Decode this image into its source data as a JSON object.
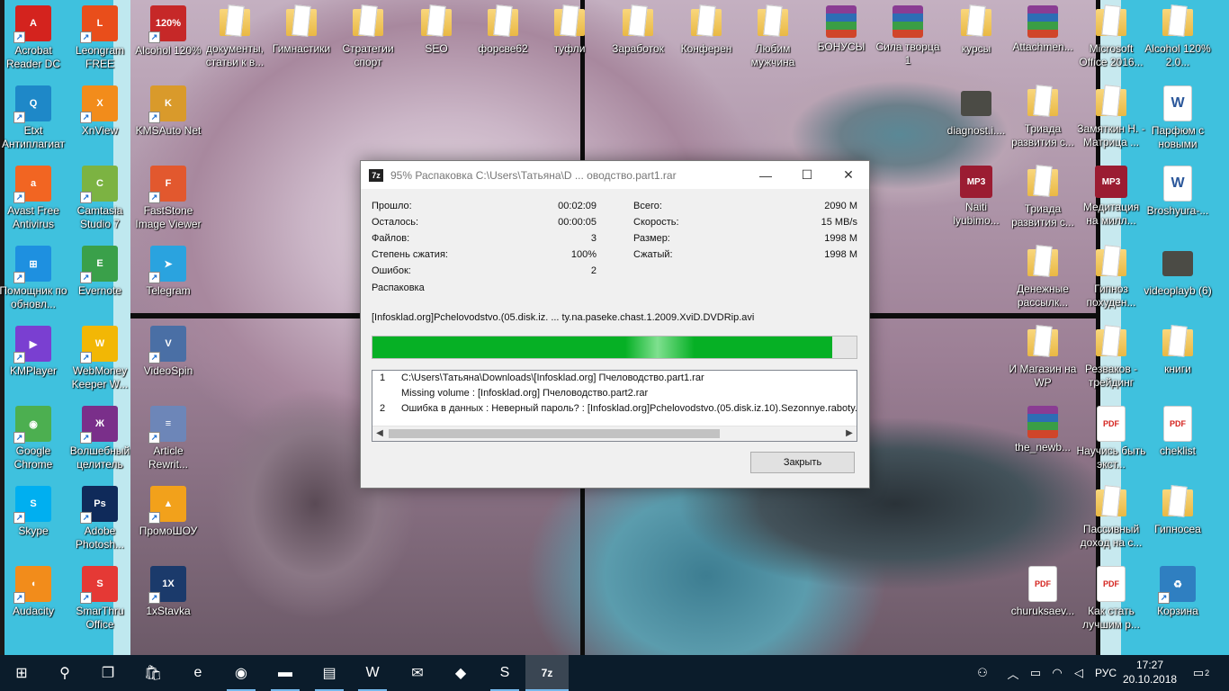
{
  "desktop": {
    "icons": [
      {
        "label": "Acrobat Reader DC",
        "icon": "acrobat-icon",
        "color": "#d4231e",
        "glyph": "A"
      },
      {
        "label": "Leongram FREE",
        "icon": "leongram-icon",
        "color": "#e94e1b",
        "glyph": "L"
      },
      {
        "label": "Alcohol 120%",
        "icon": "alcohol-icon",
        "color": "#c62828",
        "glyph": "120%"
      },
      {
        "label": "документы, статьи к в...",
        "icon": "folder-icon"
      },
      {
        "label": "Гимнастики",
        "icon": "folder-icon"
      },
      {
        "label": "Стратегии спорт",
        "icon": "folder-icon"
      },
      {
        "label": "SEO",
        "icon": "folder-icon"
      },
      {
        "label": "форсве62",
        "icon": "folder-icon"
      },
      {
        "label": "туфли",
        "icon": "folder-icon"
      },
      {
        "label": "Заработок",
        "icon": "folder-icon"
      },
      {
        "label": "Конферен",
        "icon": "folder-icon"
      },
      {
        "label": "Любим мужчина",
        "icon": "folder-icon"
      },
      {
        "label": "БОНУСЫ",
        "icon": "rar-archive-icon"
      },
      {
        "label": "Сила творца 1",
        "icon": "rar-archive-icon"
      },
      {
        "label": "курсы",
        "icon": "folder-icon"
      },
      {
        "label": "Attachmen...",
        "icon": "rar-archive-icon"
      },
      {
        "label": "Microsoft Office 2016...",
        "icon": "folder-icon"
      },
      {
        "label": "Alcohol 120% 2.0...",
        "icon": "folder-icon"
      },
      {
        "label": "Etxt Антиплагиат",
        "icon": "etxt-icon",
        "color": "#1e88c8",
        "glyph": "Q"
      },
      {
        "label": "XnView",
        "icon": "xnview-icon",
        "color": "#f28c1b",
        "glyph": "X"
      },
      {
        "label": "KMSAuto Net",
        "icon": "kmsauto-icon",
        "color": "#d99a2b",
        "glyph": "K"
      },
      {
        "label": "diagnost.i....",
        "icon": "video-thumbnail-icon"
      },
      {
        "label": "Триада развития с...",
        "icon": "folder-icon"
      },
      {
        "label": "Замяткин Н. - Матрица ...",
        "icon": "folder-icon"
      },
      {
        "label": "Парфюм с новыми",
        "icon": "word-document-icon"
      },
      {
        "label": "Avast Free Antivirus",
        "icon": "avast-icon",
        "color": "#f26522",
        "glyph": "a"
      },
      {
        "label": "Camtasia Studio 7",
        "icon": "camtasia-icon",
        "color": "#7cb342",
        "glyph": "C"
      },
      {
        "label": "FastStone Image Viewer",
        "icon": "faststone-icon",
        "color": "#e2582e",
        "glyph": "F"
      },
      {
        "label": "Naiti lyubimo...",
        "icon": "mp3-icon"
      },
      {
        "label": "Триада развития с...",
        "icon": "folder-icon"
      },
      {
        "label": "Медитация на милл...",
        "icon": "mp3-icon"
      },
      {
        "label": "Broshyura-...",
        "icon": "word-document-icon"
      },
      {
        "label": "Помощник по обновл...",
        "icon": "windows-update-icon",
        "color": "#1e90e0",
        "glyph": "⊞"
      },
      {
        "label": "Evernote",
        "icon": "evernote-icon",
        "color": "#3aa04a",
        "glyph": "E"
      },
      {
        "label": "Telegram",
        "icon": "telegram-icon",
        "color": "#2aa3df",
        "glyph": "➤"
      },
      {
        "label": "Денежные рассылк...",
        "icon": "folder-icon"
      },
      {
        "label": "Гипноз похуден...",
        "icon": "folder-icon"
      },
      {
        "label": "videoplayb (6)",
        "icon": "video-thumbnail-icon"
      },
      {
        "label": "KMPlayer",
        "icon": "kmplayer-icon",
        "color": "#7a3fd1",
        "glyph": "▶"
      },
      {
        "label": "WebMoney Keeper W...",
        "icon": "webmoney-icon",
        "color": "#f2b705",
        "glyph": "W"
      },
      {
        "label": "VideoSpin",
        "icon": "videospin-icon",
        "color": "#4a6fa5",
        "glyph": "V"
      },
      {
        "label": "И Магазин на WP",
        "icon": "folder-icon"
      },
      {
        "label": "Резваков - трейдинг",
        "icon": "folder-icon"
      },
      {
        "label": "книги",
        "icon": "folder-icon"
      },
      {
        "label": "Google Chrome",
        "icon": "chrome-icon",
        "color": "#4caf50",
        "glyph": "◉"
      },
      {
        "label": "Волшебный целитель",
        "icon": "healer-icon",
        "color": "#7a2f8a",
        "glyph": "Ж"
      },
      {
        "label": "Article Rewrit...",
        "icon": "article-rewriter-icon",
        "color": "#6d86b8",
        "glyph": "≡"
      },
      {
        "label": "the_newb...",
        "icon": "rar-archive-icon"
      },
      {
        "label": "Научись быть экст...",
        "icon": "pdf-icon"
      },
      {
        "label": "cheklist",
        "icon": "pdf-icon"
      },
      {
        "label": "Skype",
        "icon": "skype-icon",
        "color": "#00aff0",
        "glyph": "S"
      },
      {
        "label": "Adobe Photosh...",
        "icon": "photoshop-icon",
        "color": "#0f2a5a",
        "glyph": "Ps"
      },
      {
        "label": "ПромоШОУ",
        "icon": "promoshow-icon",
        "color": "#f2a11b",
        "glyph": "▲"
      },
      {
        "label": "Пассивный доход на с...",
        "icon": "folder-icon"
      },
      {
        "label": "Гипносеа",
        "icon": "folder-icon"
      },
      {
        "label": "Audacity",
        "icon": "audacity-icon",
        "color": "#f28c1b",
        "glyph": "◖"
      },
      {
        "label": "SmarThru Office",
        "icon": "smarthru-icon",
        "color": "#e53935",
        "glyph": "S"
      },
      {
        "label": "1xStavka",
        "icon": "1xstavka-icon",
        "color": "#1b3a6b",
        "glyph": "1X"
      },
      {
        "label": "churuksaev...",
        "icon": "pdf-icon"
      },
      {
        "label": "Как стать лучшим р...",
        "icon": "pdf-icon"
      },
      {
        "label": "Корзина",
        "icon": "recycle-bin-icon",
        "color": "#2f7fc1",
        "glyph": "♻"
      }
    ]
  },
  "dialog": {
    "icon_label": "7z",
    "title": "95% Распаковка C:\\Users\\Татьяна\\D ... оводство.part1.rar",
    "stats_left": [
      {
        "label": "Прошло:",
        "value": "00:02:09"
      },
      {
        "label": "Осталось:",
        "value": "00:00:05"
      },
      {
        "label": "Файлов:",
        "value": "3"
      },
      {
        "label": "Степень сжатия:",
        "value": "100%"
      },
      {
        "label": "Ошибок:",
        "value": "2"
      }
    ],
    "stats_right": [
      {
        "label": "Всего:",
        "value": "2090 M"
      },
      {
        "label": "Скорость:",
        "value": "15 MB/s"
      },
      {
        "label": "Размер:",
        "value": "1998 M"
      },
      {
        "label": "Сжатый:",
        "value": "1998 M"
      }
    ],
    "operation": "Распаковка",
    "current_file": "[Infosklad.org]Pchelovodstvo.(05.disk.iz. ... ty.na.paseke.chast.1.2009.XviD.DVDRip.avi",
    "progress": 0.95,
    "log": [
      {
        "num": "1",
        "text": "C:\\Users\\Татьяна\\Downloads\\[Infosklad.org] Пчеловодство.part1.rar"
      },
      {
        "num": "",
        "text": "Missing volume : [Infosklad.org] Пчеловодство.part2.rar"
      },
      {
        "num": "2",
        "text": "Ошибка в данных : Неверный пароль? : [Infosklad.org]Pchelovodstvo.(05.disk.iz.10).Sezonnye.raboty.na"
      }
    ],
    "close_label": "Закрыть"
  },
  "taskbar": {
    "items": [
      {
        "icon": "windows-start-icon",
        "glyph": "⊞"
      },
      {
        "icon": "search-icon",
        "glyph": "⚲"
      },
      {
        "icon": "task-view-icon",
        "glyph": "❐"
      },
      {
        "icon": "store-icon",
        "glyph": "🛍"
      },
      {
        "icon": "edge-icon",
        "glyph": "e"
      },
      {
        "icon": "chrome-icon",
        "glyph": "◉"
      },
      {
        "icon": "file-explorer-icon",
        "glyph": "▬"
      },
      {
        "icon": "winrar-icon",
        "glyph": "▤"
      },
      {
        "icon": "word-icon",
        "glyph": "W"
      },
      {
        "icon": "mail-icon",
        "glyph": "✉"
      },
      {
        "icon": "sticky-app-icon",
        "glyph": "◆"
      },
      {
        "icon": "skype-icon",
        "glyph": "S"
      },
      {
        "icon": "7zip-icon",
        "glyph": "7z"
      }
    ],
    "language": "РУС",
    "time": "17:27",
    "date": "20.10.2018",
    "notification_count": "2"
  },
  "colors": {
    "progress_green": "#06b025",
    "taskbar": "#0b1c2b",
    "accent": "#76b9ed"
  }
}
